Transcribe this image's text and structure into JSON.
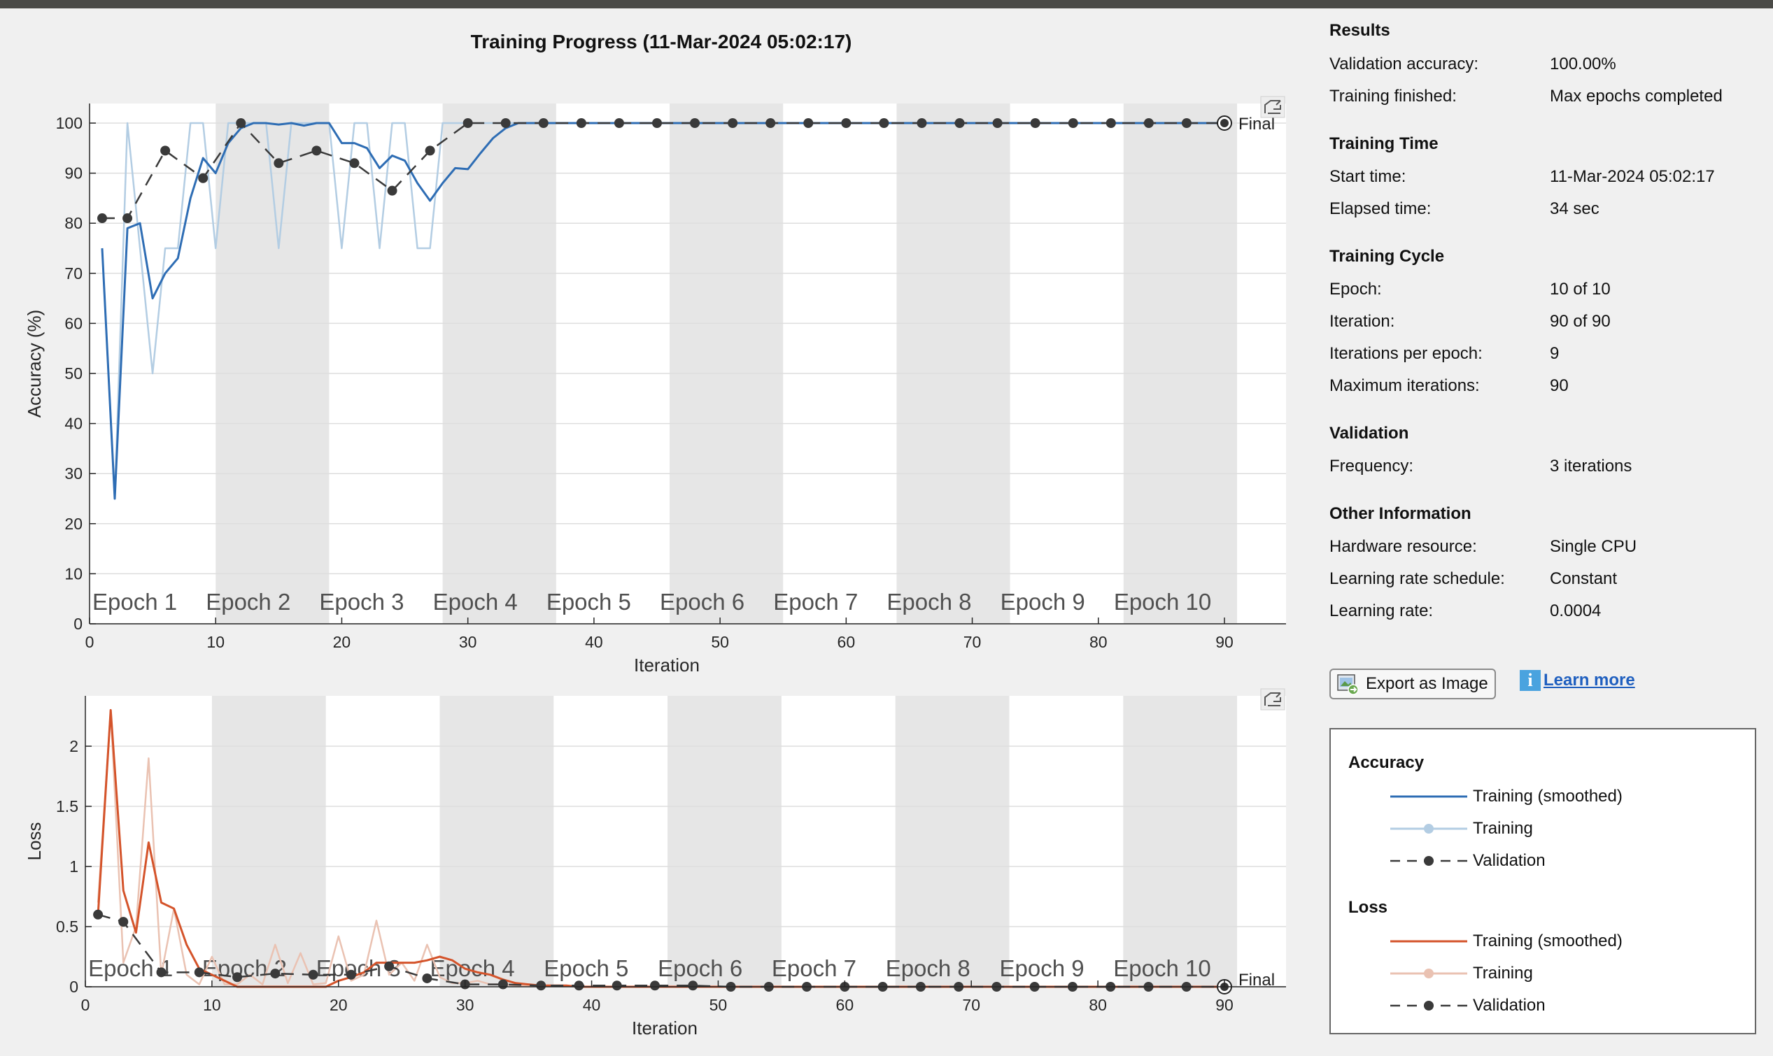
{
  "title": "Training Progress (11-Mar-2024 05:02:17)",
  "info": {
    "results": {
      "heading": "Results",
      "rows": [
        {
          "label": "Validation accuracy:",
          "value": "100.00%"
        },
        {
          "label": "Training finished:",
          "value": "Max epochs completed"
        }
      ]
    },
    "training_time": {
      "heading": "Training Time",
      "rows": [
        {
          "label": "Start time:",
          "value": "11-Mar-2024 05:02:17"
        },
        {
          "label": "Elapsed time:",
          "value": "34 sec"
        }
      ]
    },
    "training_cycle": {
      "heading": "Training Cycle",
      "rows": [
        {
          "label": "Epoch:",
          "value": "10 of 10"
        },
        {
          "label": "Iteration:",
          "value": "90 of 90"
        },
        {
          "label": "Iterations per epoch:",
          "value": "9"
        },
        {
          "label": "Maximum iterations:",
          "value": "90"
        }
      ]
    },
    "validation": {
      "heading": "Validation",
      "rows": [
        {
          "label": "Frequency:",
          "value": "3 iterations"
        }
      ]
    },
    "other": {
      "heading": "Other Information",
      "rows": [
        {
          "label": "Hardware resource:",
          "value": "Single CPU"
        },
        {
          "label": "Learning rate schedule:",
          "value": "Constant"
        },
        {
          "label": "Learning rate:",
          "value": "0.0004"
        }
      ]
    }
  },
  "buttons": {
    "export": "Export as Image",
    "learn_more": "Learn more"
  },
  "legend": {
    "accuracy_heading": "Accuracy",
    "loss_heading": "Loss",
    "training_smoothed": "Training (smoothed)",
    "training": "Training",
    "validation": "Validation"
  },
  "colors": {
    "acc_smoothed": "#2e6db4",
    "acc_raw": "#b3cde3",
    "loss_smoothed": "#d4532a",
    "loss_raw": "#eac2b2",
    "validation": "#3a3a3a",
    "epoch_shade": "#e6e6e6"
  },
  "chart_data": [
    {
      "type": "line",
      "xlabel": "Iteration",
      "ylabel": "Accuracy (%)",
      "xlim": [
        0,
        95
      ],
      "ylim": [
        0,
        100
      ],
      "xticks": [
        0,
        10,
        20,
        30,
        40,
        50,
        60,
        70,
        80,
        90
      ],
      "yticks": [
        0,
        10,
        20,
        30,
        40,
        50,
        60,
        70,
        80,
        90,
        100
      ],
      "epochs": [
        "Epoch 1",
        "Epoch 2",
        "Epoch 3",
        "Epoch 4",
        "Epoch 5",
        "Epoch 6",
        "Epoch 7",
        "Epoch 8",
        "Epoch 9",
        "Epoch 10"
      ],
      "final_label": "Final",
      "series": [
        {
          "name": "Training",
          "kind": "raw",
          "x": [
            1,
            2,
            3,
            4,
            5,
            6,
            7,
            8,
            9,
            10,
            11,
            12,
            13,
            14,
            15,
            16,
            17,
            18,
            19,
            20,
            21,
            22,
            23,
            24,
            25,
            26,
            27,
            28,
            29,
            30,
            31,
            32,
            33,
            34,
            35,
            36,
            37,
            38,
            39,
            40,
            41,
            42,
            43,
            44,
            45,
            46,
            47,
            48,
            49,
            50,
            51,
            52,
            53,
            54,
            55,
            56,
            57,
            58,
            59,
            60,
            61,
            62,
            63,
            64,
            65,
            66,
            67,
            68,
            69,
            70,
            71,
            72,
            73,
            74,
            75,
            76,
            77,
            78,
            79,
            80,
            81,
            82,
            83,
            84,
            85,
            86,
            87,
            88,
            89,
            90
          ],
          "y": [
            75,
            25,
            100,
            75,
            50,
            75,
            75,
            100,
            100,
            75,
            100,
            100,
            100,
            100,
            75,
            100,
            100,
            100,
            100,
            75,
            100,
            100,
            75,
            100,
            100,
            75,
            75,
            100,
            100,
            100,
            100,
            100,
            100,
            100,
            100,
            100,
            100,
            100,
            100,
            100,
            100,
            100,
            100,
            100,
            100,
            100,
            100,
            100,
            100,
            100,
            100,
            100,
            100,
            100,
            100,
            100,
            100,
            100,
            100,
            100,
            100,
            100,
            100,
            100,
            100,
            100,
            100,
            100,
            100,
            100,
            100,
            100,
            100,
            100,
            100,
            100,
            100,
            100,
            100,
            100,
            100,
            100,
            100,
            100,
            100,
            100,
            100,
            100,
            100,
            100
          ]
        },
        {
          "name": "Training (smoothed)",
          "kind": "smoothed",
          "x": [
            1,
            2,
            3,
            4,
            5,
            6,
            7,
            8,
            9,
            10,
            11,
            12,
            13,
            14,
            15,
            16,
            17,
            18,
            19,
            20,
            21,
            22,
            23,
            24,
            25,
            26,
            27,
            28,
            29,
            30,
            31,
            32,
            33,
            34,
            35,
            36,
            37,
            38,
            39,
            40,
            41,
            42,
            43,
            44,
            45,
            46,
            47,
            48,
            49,
            50,
            51,
            52,
            53,
            54,
            55,
            56,
            57,
            58,
            59,
            60,
            61,
            62,
            63,
            64,
            65,
            66,
            67,
            68,
            69,
            70,
            71,
            72,
            73,
            74,
            75,
            76,
            77,
            78,
            79,
            80,
            81,
            82,
            83,
            84,
            85,
            86,
            87,
            88,
            89,
            90
          ],
          "y": [
            75,
            25,
            79,
            80,
            65,
            70,
            73,
            85,
            93,
            90,
            96,
            99,
            100,
            100,
            99.7,
            100,
            99.5,
            100,
            100,
            96,
            96,
            95,
            91,
            93.5,
            92.5,
            88,
            84.5,
            88,
            91,
            90.8,
            94,
            97,
            99,
            100,
            100,
            100,
            100,
            100,
            100,
            100,
            100,
            100,
            100,
            100,
            100,
            100,
            100,
            100,
            100,
            100,
            100,
            100,
            100,
            100,
            100,
            100,
            100,
            100,
            100,
            100,
            100,
            100,
            100,
            100,
            100,
            100,
            100,
            100,
            100,
            100,
            100,
            100,
            100,
            100,
            100,
            100,
            100,
            100,
            100,
            100,
            100,
            100,
            100,
            100,
            100,
            100,
            100,
            100,
            100,
            100
          ]
        },
        {
          "name": "Validation",
          "kind": "validation",
          "x": [
            1,
            3,
            6,
            9,
            12,
            15,
            18,
            21,
            24,
            27,
            30,
            33,
            36,
            39,
            42,
            45,
            48,
            51,
            54,
            57,
            60,
            63,
            66,
            69,
            72,
            75,
            78,
            81,
            84,
            87,
            90
          ],
          "y": [
            81,
            81,
            94.5,
            89,
            100,
            92,
            94.5,
            92,
            86.5,
            94.5,
            100,
            100,
            100,
            100,
            100,
            100,
            100,
            100,
            100,
            100,
            100,
            100,
            100,
            100,
            100,
            100,
            100,
            100,
            100,
            100,
            100
          ]
        }
      ]
    },
    {
      "type": "line",
      "xlabel": "Iteration",
      "ylabel": "Loss",
      "xlim": [
        0,
        95
      ],
      "ylim": [
        0,
        2.4
      ],
      "xticks": [
        0,
        10,
        20,
        30,
        40,
        50,
        60,
        70,
        80,
        90
      ],
      "yticks": [
        0,
        0.5,
        1,
        1.5,
        2
      ],
      "epochs": [
        "Epoch 1",
        "Epoch 2",
        "Epoch 3",
        "Epoch 4",
        "Epoch 5",
        "Epoch 6",
        "Epoch 7",
        "Epoch 8",
        "Epoch 9",
        "Epoch 10"
      ],
      "final_label": "Final",
      "series": [
        {
          "name": "Training",
          "kind": "raw",
          "x": [
            1,
            2,
            3,
            4,
            5,
            6,
            7,
            8,
            9,
            10,
            11,
            12,
            13,
            14,
            15,
            16,
            17,
            18,
            19,
            20,
            21,
            22,
            23,
            24,
            25,
            26,
            27,
            28,
            29,
            30,
            31,
            32,
            33,
            34,
            35,
            36,
            37,
            38,
            39,
            40,
            41,
            42,
            43,
            44,
            45,
            46,
            47,
            48,
            49,
            50,
            51,
            52,
            53,
            54,
            55,
            56,
            57,
            58,
            59,
            60,
            61,
            62,
            63,
            64,
            65,
            66,
            67,
            68,
            69,
            70,
            71,
            72,
            73,
            74,
            75,
            76,
            77,
            78,
            79,
            80,
            81,
            82,
            83,
            84,
            85,
            86,
            87,
            88,
            89,
            90
          ],
          "y": [
            0.7,
            2.3,
            0.2,
            0.5,
            1.9,
            0.1,
            0.65,
            0.1,
            0.02,
            0.25,
            0.02,
            0.02,
            0.1,
            0.02,
            0.35,
            0.03,
            0.28,
            0.02,
            0.03,
            0.42,
            0.05,
            0.1,
            0.55,
            0.1,
            0.2,
            0.05,
            0.35,
            0.08,
            0.03,
            0.03,
            0.05,
            0.02,
            0.02,
            0.01,
            0.01,
            0.01,
            0.01,
            0.01,
            0,
            0,
            0,
            0,
            0,
            0,
            0,
            0,
            0,
            0,
            0,
            0,
            0,
            0,
            0,
            0,
            0,
            0,
            0,
            0,
            0,
            0,
            0,
            0,
            0,
            0,
            0,
            0,
            0,
            0,
            0,
            0,
            0,
            0,
            0,
            0,
            0,
            0,
            0,
            0,
            0,
            0,
            0,
            0,
            0,
            0,
            0,
            0,
            0,
            0,
            0,
            0
          ]
        },
        {
          "name": "Training (smoothed)",
          "kind": "smoothed",
          "x": [
            1,
            2,
            3,
            4,
            5,
            6,
            7,
            8,
            9,
            10,
            11,
            12,
            13,
            14,
            15,
            16,
            17,
            18,
            19,
            20,
            21,
            22,
            23,
            24,
            25,
            26,
            27,
            28,
            29,
            30,
            31,
            32,
            33,
            34,
            35,
            36,
            37,
            38,
            39,
            40,
            41,
            42,
            43,
            44,
            45,
            46,
            47,
            48,
            49,
            50,
            51,
            52,
            53,
            54,
            55,
            56,
            57,
            58,
            59,
            60,
            61,
            62,
            63,
            64,
            65,
            66,
            67,
            68,
            69,
            70,
            71,
            72,
            73,
            74,
            75,
            76,
            77,
            78,
            79,
            80,
            81,
            82,
            83,
            84,
            85,
            86,
            87,
            88,
            89,
            90
          ],
          "y": [
            0.6,
            2.3,
            0.8,
            0.45,
            1.2,
            0.7,
            0.65,
            0.35,
            0.15,
            0.1,
            0.05,
            0,
            0,
            0,
            0,
            0,
            0,
            0,
            0,
            0.05,
            0.08,
            0.12,
            0.2,
            0.2,
            0.2,
            0.2,
            0.22,
            0.25,
            0.22,
            0.15,
            0.12,
            0.1,
            0.06,
            0.03,
            0.02,
            0.01,
            0.01,
            0.01,
            0,
            0,
            0,
            0,
            0,
            0,
            0,
            0,
            0,
            0,
            0,
            0,
            0,
            0,
            0,
            0,
            0,
            0,
            0,
            0,
            0,
            0,
            0,
            0,
            0,
            0,
            0,
            0,
            0,
            0,
            0,
            0,
            0,
            0,
            0,
            0,
            0,
            0,
            0,
            0,
            0,
            0,
            0,
            0,
            0,
            0,
            0,
            0,
            0,
            0,
            0,
            0
          ]
        },
        {
          "name": "Validation",
          "kind": "validation",
          "x": [
            1,
            3,
            6,
            9,
            12,
            15,
            18,
            21,
            24,
            27,
            30,
            33,
            36,
            39,
            42,
            45,
            48,
            51,
            54,
            57,
            60,
            63,
            66,
            69,
            72,
            75,
            78,
            81,
            84,
            87,
            90
          ],
          "y": [
            0.6,
            0.54,
            0.12,
            0.12,
            0.08,
            0.11,
            0.1,
            0.1,
            0.17,
            0.07,
            0.02,
            0.02,
            0.01,
            0.01,
            0.01,
            0.01,
            0.01,
            0,
            0,
            0,
            0,
            0,
            0,
            0,
            0,
            0,
            0,
            0,
            0,
            0,
            0
          ]
        }
      ]
    }
  ]
}
